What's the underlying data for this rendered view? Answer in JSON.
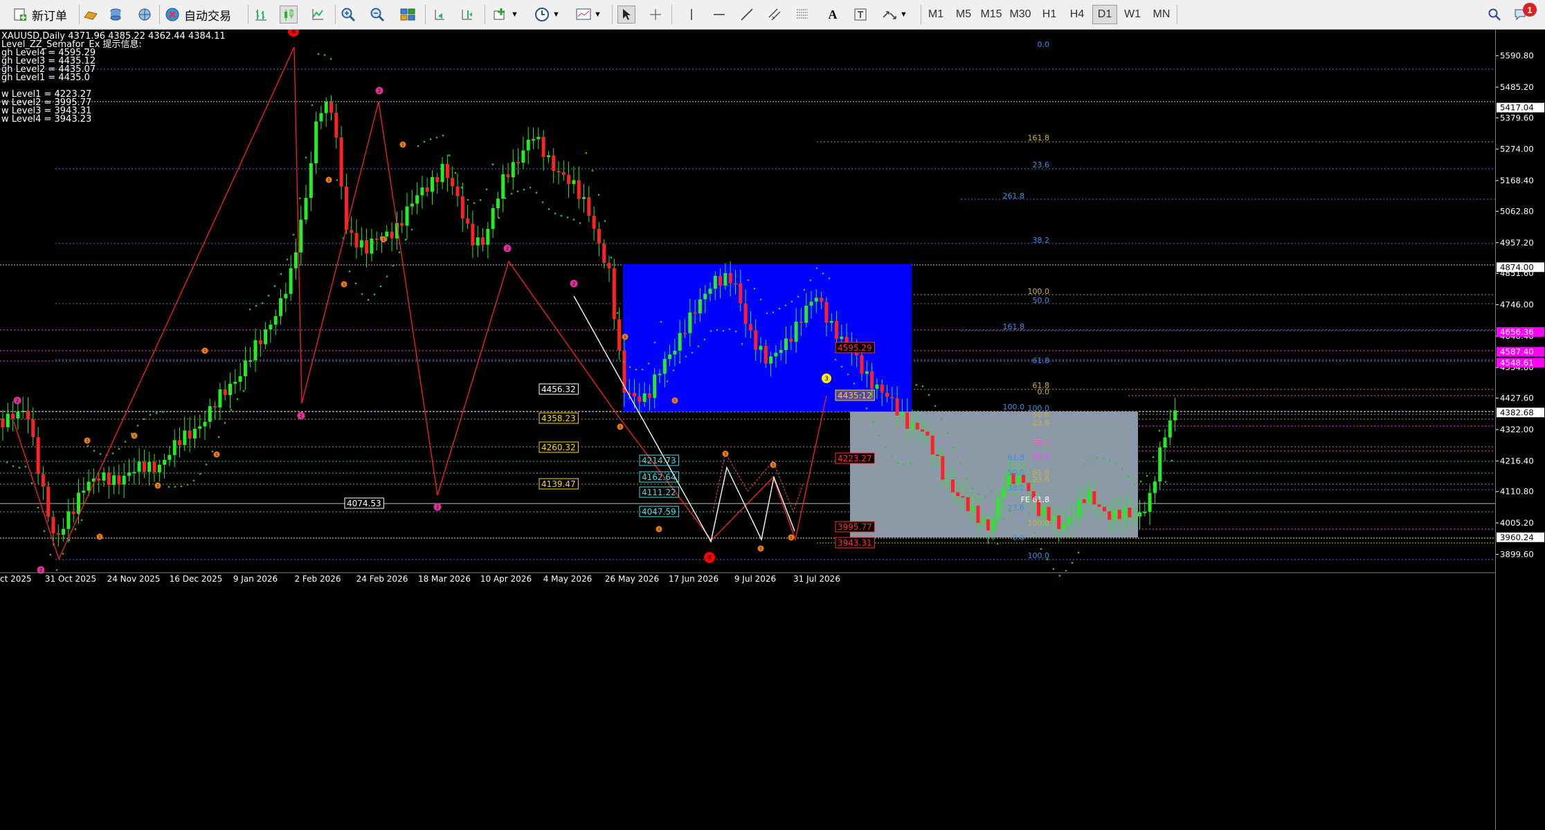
{
  "toolbar": {
    "new_order": "新订单",
    "auto_trading": "自动交易",
    "timeframes": [
      "M1",
      "M5",
      "M15",
      "M30",
      "H1",
      "H4",
      "D1",
      "W1",
      "MN"
    ],
    "active_timeframe": "D1",
    "notification_count": "1"
  },
  "chart_info": {
    "symbol_line": "XAUUSD,Daily  4371.96 4385.22 4362.44 4384.11",
    "indicator_line": "Level_ZZ_Semafor_Ex 提示信息:",
    "levels": [
      "gh Level4 = 4595.29",
      "gh Level3 = 4435.12",
      "gh Level2 = 4435.07",
      "gh Level1 = 4435.0",
      "",
      "w Level1 = 4223.27",
      "w Level2 = 3995.77",
      "w Level3 = 3943.31",
      "w Level4 = 3943.23"
    ]
  },
  "axis": {
    "prices": [
      "5590.80",
      "5485.20",
      "5379.60",
      "5274.00",
      "5168.40",
      "5062.80",
      "4957.20",
      "4851.60",
      "4746.00",
      "4640.40",
      "4534.80",
      "4427.60",
      "4322.00",
      "4216.40",
      "4110.80",
      "4005.20",
      "3899.60"
    ],
    "badges": [
      {
        "text": "5417.04",
        "bg": "#ffffff",
        "fg": "#000000"
      },
      {
        "text": "4874.00",
        "bg": "#ffffff",
        "fg": "#000000"
      },
      {
        "text": "4656.36",
        "bg": "#ff00ff",
        "fg": "#ffffff"
      },
      {
        "text": "4587.40",
        "bg": "#ff00ff",
        "fg": "#ffffff"
      },
      {
        "text": "4548.61",
        "bg": "#ff00ff",
        "fg": "#ffffff"
      },
      {
        "text": "4382.68",
        "bg": "#ffffff",
        "fg": "#000000"
      },
      {
        "text": "3960.24",
        "bg": "#ffffff",
        "fg": "#000000"
      }
    ]
  },
  "dates": [
    "ct 2025",
    "31 Oct 2025",
    "24 Nov 2025",
    "16 Dec 2025",
    "9 Jan 2026",
    "2 Feb 2026",
    "24 Feb 2026",
    "18 Mar 2026",
    "10 Apr 2026",
    "4 May 2026",
    "26 May 2026",
    "17 Jun 2026",
    "9 Jul 2026",
    "31 Jul 2026"
  ],
  "fib_labels": {
    "blue_right": [
      "0.0",
      "23.6",
      "38.2",
      "50.0",
      "61.8",
      "100.0"
    ],
    "blue_mid": [
      "261.8",
      "161.8"
    ],
    "yellow": [
      "161.8",
      "100.0",
      "61.8",
      "0.0",
      "50.0",
      "23.6",
      "38.2"
    ],
    "lower": [
      "100.0",
      "61.8",
      "50.0",
      "38.2",
      "23.6",
      "0.0",
      "100.0"
    ],
    "magenta": [
      "50.0",
      "61.8",
      "23.6",
      "38.2",
      "100.0"
    ],
    "fe": "FE 61.8"
  },
  "price_tags": {
    "white_boxed": [
      "4456.32",
      "4074.53"
    ],
    "yellow_boxed": [
      "4358.23",
      "4260.32",
      "4139.47"
    ],
    "cyan_boxed": [
      "4214.73",
      "4162.64",
      "4111.22",
      "4047.59"
    ],
    "red_boxed": [
      "4595.29",
      "4223.27",
      "3995.77",
      "3943.31"
    ],
    "yellow_highlight": "4435.12"
  },
  "markers": {
    "red_big": "4",
    "magenta": "2",
    "orange": "1",
    "yellow": "3"
  }
}
